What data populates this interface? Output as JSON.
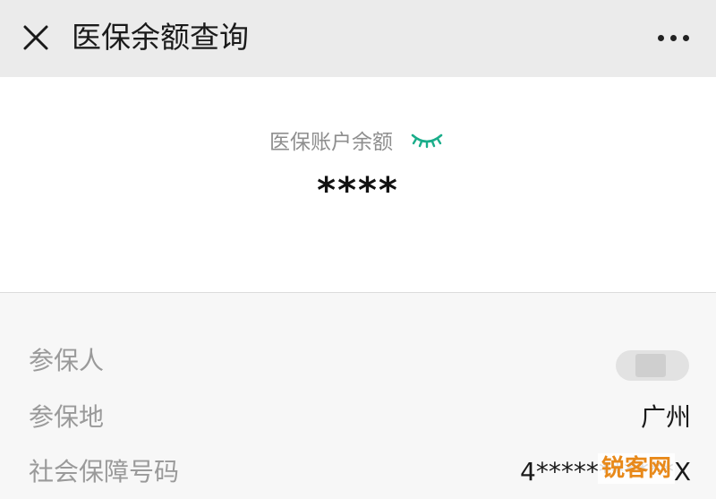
{
  "header": {
    "title": "医保余额查询",
    "close_icon": "close-icon",
    "more_icon": "more-dots-icon"
  },
  "balance": {
    "label": "医保账户余额",
    "value": "****",
    "toggle_icon": "eye-closed-icon",
    "accent_color": "#1aad8a"
  },
  "info": {
    "rows": [
      {
        "label": "参保人",
        "value": ""
      },
      {
        "label": "参保地",
        "value": "广州"
      },
      {
        "label": "社会保障号码",
        "value": "4***********X"
      }
    ]
  },
  "watermark": "锐客网"
}
